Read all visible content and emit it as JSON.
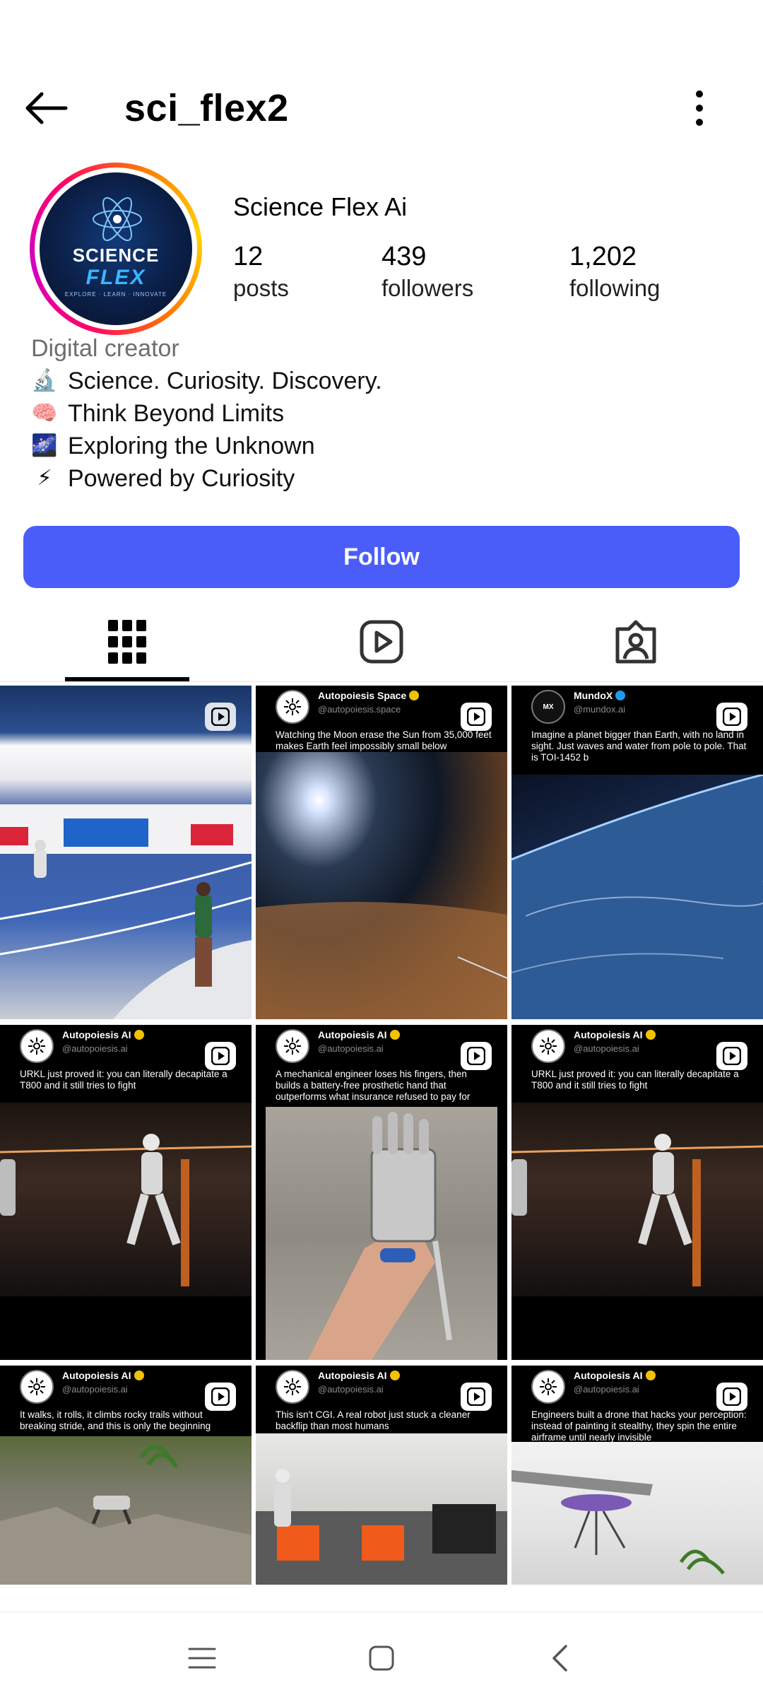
{
  "header": {
    "username": "sci_flex2"
  },
  "profile": {
    "avatar_logo_top": "SCIENCE",
    "avatar_logo_bottom": "FLEX",
    "avatar_tagline": "EXPLORE · LEARN · INNOVATE",
    "display_name": "Science Flex Ai",
    "stats": {
      "posts_count": "12",
      "posts_label": "posts",
      "followers_count": "439",
      "followers_label": "followers",
      "following_count": "1,202",
      "following_label": "following"
    },
    "category": "Digital creator",
    "bio": [
      {
        "emoji": "🔬",
        "text": "Science. Curiosity. Discovery."
      },
      {
        "emoji": "🧠",
        "text": "Think Beyond Limits"
      },
      {
        "emoji": "🌌",
        "text": "Exploring the Unknown"
      },
      {
        "emoji": "⚡",
        "text": "Powered by Curiosity"
      }
    ]
  },
  "actions": {
    "follow_label": "Follow"
  },
  "tabs": [
    "grid-icon",
    "reels-icon",
    "tagged-icon"
  ],
  "posts": [
    {
      "account": "",
      "handle": "",
      "caption": ""
    },
    {
      "account": "Autopoiesis Space",
      "handle": "@autopoiesis.space",
      "caption": "Watching the Moon erase the Sun from 35,000 feet makes Earth feel impossibly small below"
    },
    {
      "account": "MundoX",
      "handle": "@mundox.ai",
      "caption": "Imagine a planet bigger than Earth, with no land in sight. Just waves and water from pole to pole. That is TOI-1452 b"
    },
    {
      "account": "Autopoiesis AI",
      "handle": "@autopoiesis.ai",
      "caption": "URKL just proved it: you can literally decapitate a T800 and it still tries to fight"
    },
    {
      "account": "Autopoiesis AI",
      "handle": "@autopoiesis.ai",
      "caption": "A mechanical engineer loses his fingers, then builds a battery-free prosthetic hand that outperforms what insurance refused to pay for"
    },
    {
      "account": "Autopoiesis AI",
      "handle": "@autopoiesis.ai",
      "caption": "URKL just proved it: you can literally decapitate a T800 and it still tries to fight"
    },
    {
      "account": "Autopoiesis AI",
      "handle": "@autopoiesis.ai",
      "caption": "It walks, it rolls, it climbs rocky trails without breaking stride, and this is only the beginning"
    },
    {
      "account": "Autopoiesis AI",
      "handle": "@autopoiesis.ai",
      "caption": "This isn't CGI. A real robot just stuck a cleaner backflip than most humans"
    },
    {
      "account": "Autopoiesis AI",
      "handle": "@autopoiesis.ai",
      "caption": "Engineers built a drone that hacks your perception: instead of painting it stealthy, they spin the entire airframe until nearly invisible"
    }
  ],
  "colors": {
    "follow_button": "#4a5df9",
    "verified_gold": "#f2c200",
    "verified_blue": "#1d9bf0"
  }
}
